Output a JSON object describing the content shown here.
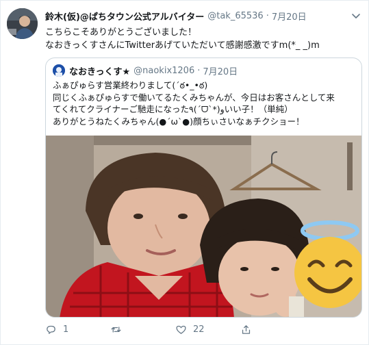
{
  "tweet": {
    "name": "鈴木(仮)@ぱちタウン公式アルバイター",
    "handle": "@tak_65536",
    "separator": "·",
    "date": "7月20日",
    "text": "こちらこそありがとうございました！\nなおきっくすさんにTwitterあげていただいて感謝感激ですm(*_ _)m",
    "text_lines": [
      "こちらこそありがとうございました！",
      "なおきっくすさんにTwitterあげていただいて感謝感激ですm(*_ _)m"
    ]
  },
  "quote": {
    "name": "なおきっくす★",
    "handle": "@naokix1206",
    "separator": "·",
    "date": "7月20日",
    "lines": [
      "ふぁぴゅらす営業終わりまして(´ఠ•_•ఠ)",
      "同じくふぁぴゅらすで働いてるたくみちゃんが、今日はお客さんとして来",
      "てくれてクライナーご馳走になった٩(ˊᗜˋ*)وいい子！（単純）",
      "ありがとうねたくみちゃん(●´ω`●)顔ちぃさいなぁチクショー！"
    ]
  },
  "actions": {
    "reply_count": "1",
    "retweet_count": "",
    "like_count": "22"
  },
  "colors": {
    "text": "#14171a",
    "muted": "#657786",
    "border": "#ccd6dd",
    "photo_shirt": "#c2151f",
    "emoji": "#f5c542",
    "halo": "#8ec9f2"
  },
  "icons": [
    "chevron-down-icon",
    "reply-icon",
    "retweet-icon",
    "like-icon",
    "share-icon"
  ]
}
